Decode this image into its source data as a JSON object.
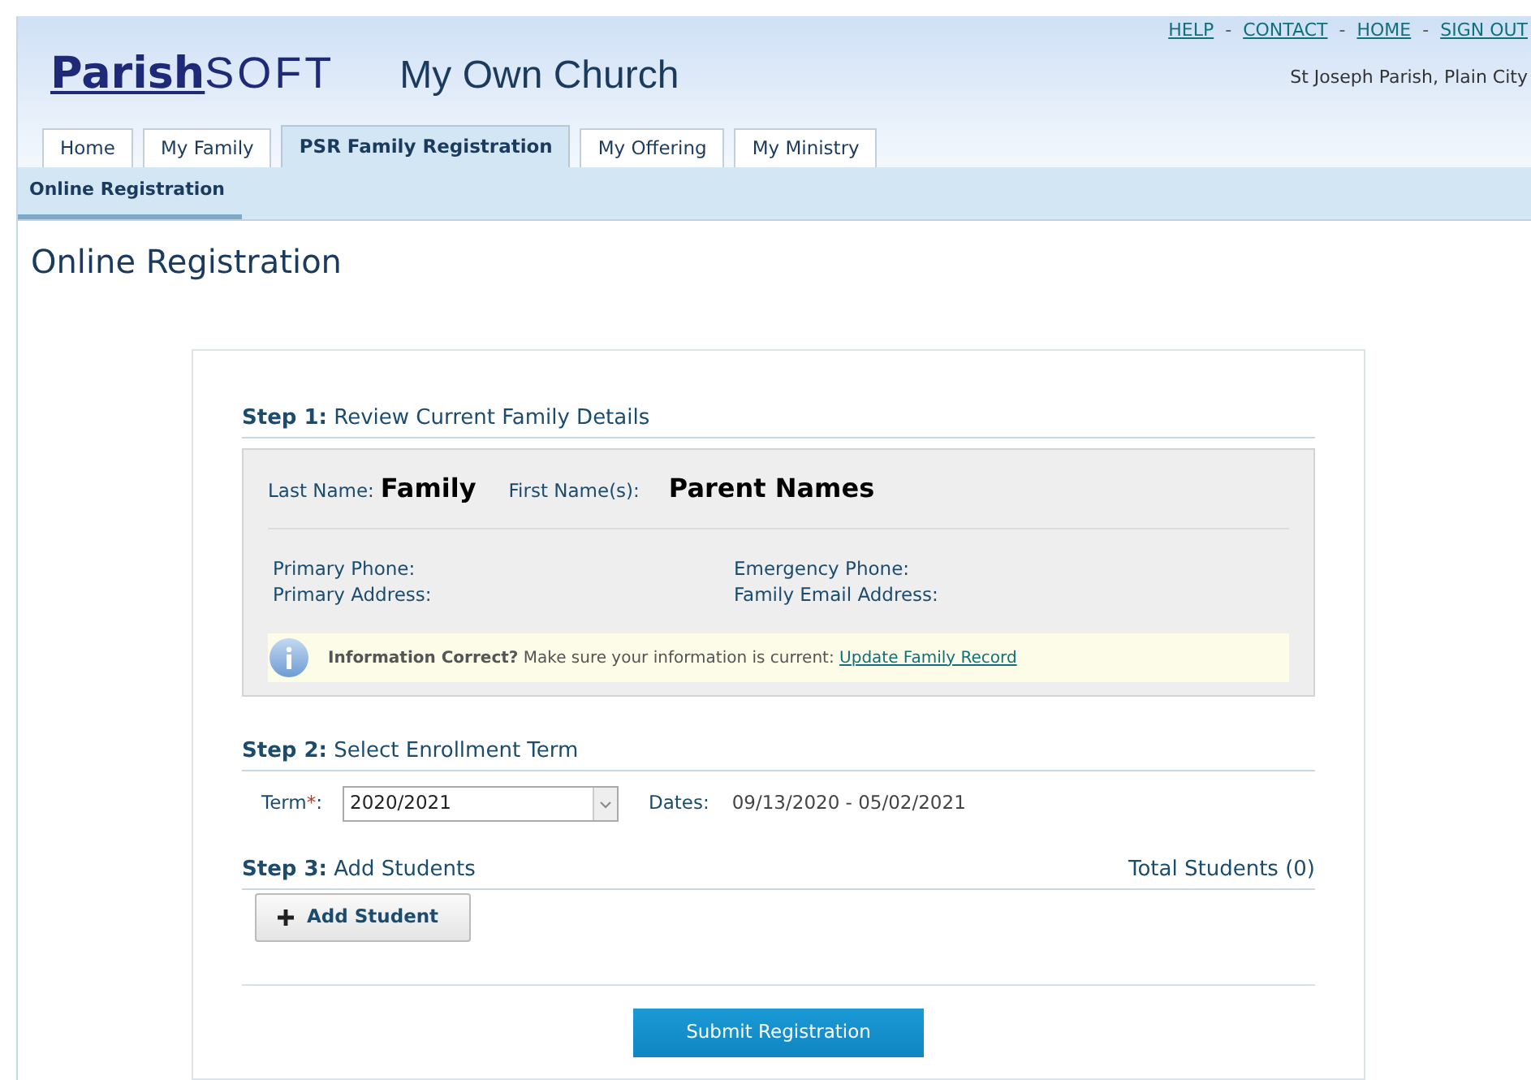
{
  "top_links": [
    "HELP",
    "CONTACT",
    "HOME",
    "SIGN OUT"
  ],
  "top_link_separator": "-",
  "logo": {
    "main": "Parish",
    "suffix": "SOFT"
  },
  "site_title": "My Own Church",
  "parish": "St Joseph Parish, Plain City",
  "tabs": [
    {
      "label": "Home",
      "selected": false
    },
    {
      "label": "My Family",
      "selected": false
    },
    {
      "label": "PSR Family Registration",
      "selected": true
    },
    {
      "label": "My Offering",
      "selected": false
    },
    {
      "label": "My Ministry",
      "selected": false
    }
  ],
  "subnav": [
    {
      "label": "Online Registration",
      "selected": true
    }
  ],
  "page_title": "Online Registration",
  "step1": {
    "heading": "**Step 1:** Review Current Family Details",
    "last_name_label": "Last Name:",
    "last_name": "Family",
    "first_name_label": "First Name(s):",
    "first_name": "Parent Names",
    "fields": [
      [
        "Primary Phone:",
        "Emergency Phone:"
      ],
      [
        "Primary Address:",
        "Family Email Address:"
      ]
    ],
    "info": {
      "text": "**Information Correct?** Make sure your information is current: ",
      "link": "Update Family Record"
    }
  },
  "step2": {
    "heading": "**Step 2:** Select Enrollment Term",
    "term_label": "Term",
    "required_mark": "*",
    "label_end": ":",
    "term_value": "2020/2021",
    "dates_label": "Dates:",
    "dates": "09/13/2020 - 05/02/2021"
  },
  "step3": {
    "heading": "**Step 3:** Add Students",
    "total": "Total Students (0)",
    "add_button": "Add Student"
  },
  "submit_button": "Submit Registration"
}
